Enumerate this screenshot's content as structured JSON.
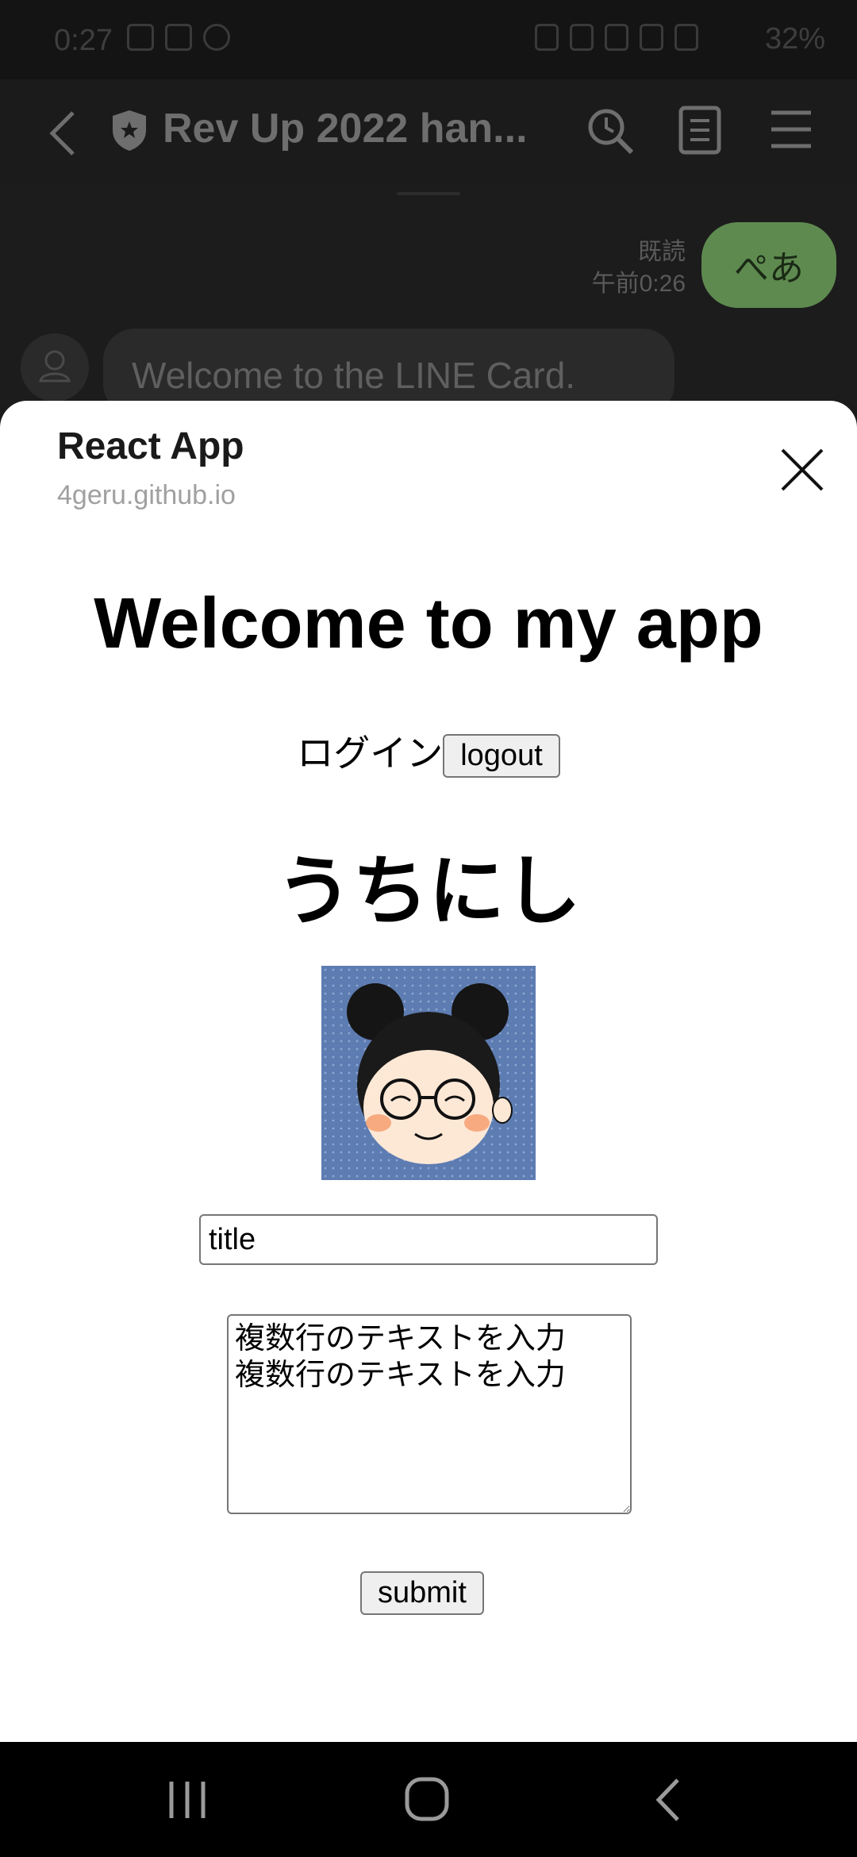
{
  "status_bar": {
    "time": "0:27",
    "battery": "32%"
  },
  "chat_header": {
    "title": "Rev Up 2022 han..."
  },
  "chat": {
    "my_message": "ぺあ",
    "read_label": "既読",
    "timestamp": "午前0:26",
    "their_message": "Welcome to the LINE Card."
  },
  "sheet": {
    "app_name": "React App",
    "domain": "4geru.github.io",
    "heading": "Welcome to my app",
    "login_text": "ログイン",
    "logout_label": "logout",
    "user_name": "うちにし",
    "title_input_value": "title",
    "textarea_value": "複数行のテキストを入力\n複数行のテキストを入力",
    "submit_label": "submit"
  },
  "colors": {
    "line_green": "#5e8a50",
    "sheet_bg": "#ffffff",
    "dark_bg": "#1b1b1b"
  }
}
